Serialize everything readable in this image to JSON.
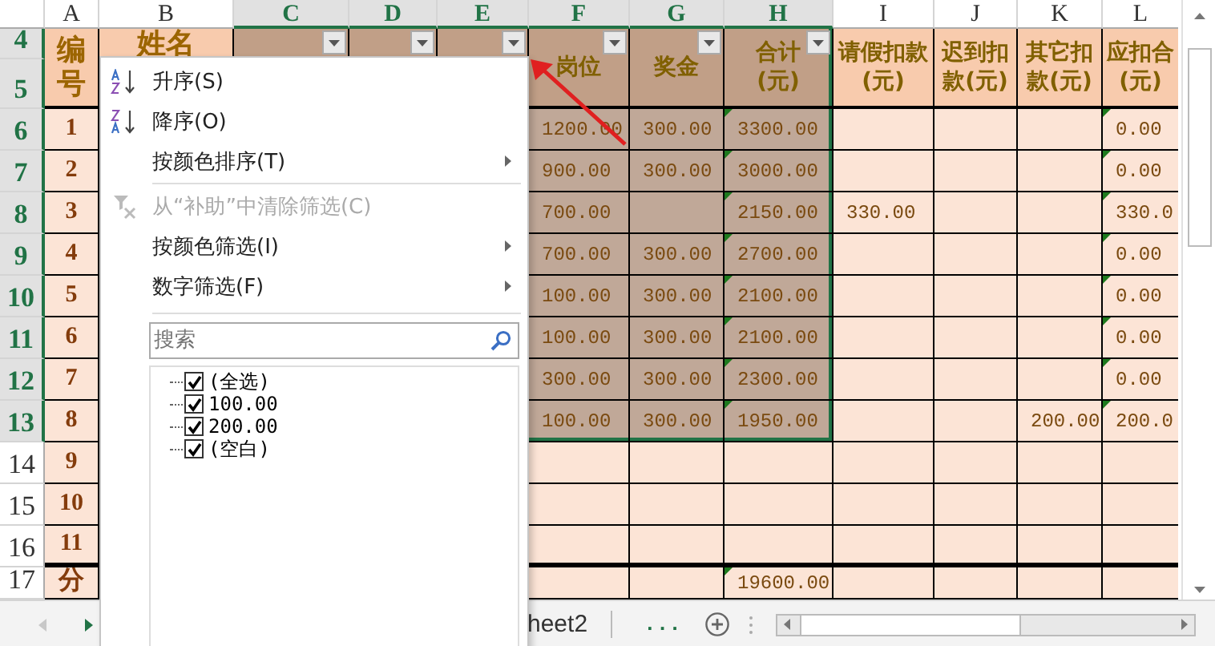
{
  "column_headers": [
    {
      "label": "A",
      "selected": false
    },
    {
      "label": "B",
      "selected": false
    },
    {
      "label": "C",
      "selected": true
    },
    {
      "label": "D",
      "selected": true
    },
    {
      "label": "E",
      "selected": true
    },
    {
      "label": "F",
      "selected": true
    },
    {
      "label": "G",
      "selected": true
    },
    {
      "label": "H",
      "selected": true
    },
    {
      "label": "I",
      "selected": false
    },
    {
      "label": "J",
      "selected": false
    },
    {
      "label": "K",
      "selected": false
    },
    {
      "label": "L",
      "selected": false
    }
  ],
  "header_rows": {
    "row_labels": [
      {
        "label": "4",
        "selected": true
      },
      {
        "label": "5",
        "selected": true
      }
    ],
    "cells": [
      {
        "text": "编号",
        "filter": false
      },
      {
        "text": "姓名",
        "filter": false
      },
      {
        "filter": true
      },
      {
        "filter": true
      },
      {
        "filter": true
      },
      {
        "text": "岗位",
        "filter": true
      },
      {
        "text": "奖金",
        "filter": true
      },
      {
        "text": "合计\n(元)",
        "filter": true
      },
      {
        "text": "请假扣款\n(元)",
        "filter": false
      },
      {
        "text": "迟到扣款(元)",
        "filter": false
      },
      {
        "text": "其它扣款(元)",
        "filter": false
      },
      {
        "text": "应扣合\n(元)",
        "filter": false
      }
    ]
  },
  "rows": [
    {
      "label": "6",
      "selected": true,
      "cells": [
        "1",
        "1200.00",
        "300.00",
        "3300.00",
        null,
        null,
        null,
        "0.00"
      ],
      "flagged": [
        false,
        false,
        false,
        true,
        false,
        false,
        false,
        true
      ]
    },
    {
      "label": "7",
      "selected": true,
      "cells": [
        "2",
        "900.00",
        "300.00",
        "3000.00",
        null,
        null,
        null,
        "0.00"
      ],
      "flagged": [
        false,
        false,
        false,
        true,
        false,
        false,
        false,
        true
      ]
    },
    {
      "label": "8",
      "selected": true,
      "cells": [
        "3",
        "700.00",
        null,
        "2150.00",
        "330.00",
        null,
        null,
        "330.0"
      ],
      "flagged": [
        false,
        false,
        false,
        true,
        false,
        false,
        false,
        true
      ]
    },
    {
      "label": "9",
      "selected": true,
      "cells": [
        "4",
        "700.00",
        "300.00",
        "2700.00",
        null,
        null,
        null,
        "0.00"
      ],
      "flagged": [
        false,
        false,
        false,
        true,
        false,
        false,
        false,
        true
      ]
    },
    {
      "label": "10",
      "selected": true,
      "cells": [
        "5",
        "100.00",
        "300.00",
        "2100.00",
        null,
        null,
        null,
        "0.00"
      ],
      "flagged": [
        false,
        false,
        false,
        true,
        false,
        false,
        false,
        true
      ]
    },
    {
      "label": "11",
      "selected": true,
      "cells": [
        "6",
        "100.00",
        "300.00",
        "2100.00",
        null,
        null,
        null,
        "0.00"
      ],
      "flagged": [
        false,
        false,
        false,
        true,
        false,
        false,
        false,
        true
      ]
    },
    {
      "label": "12",
      "selected": true,
      "cells": [
        "7",
        "300.00",
        "300.00",
        "2300.00",
        null,
        null,
        null,
        "0.00"
      ],
      "flagged": [
        false,
        false,
        false,
        true,
        false,
        false,
        false,
        true
      ]
    },
    {
      "label": "13",
      "selected": true,
      "cells": [
        "8",
        "100.00",
        "300.00",
        "1950.00",
        null,
        null,
        "200.00",
        "200.0"
      ],
      "flagged": [
        false,
        false,
        false,
        true,
        false,
        false,
        false,
        true
      ]
    },
    {
      "label": "14",
      "selected": false,
      "cells": [
        "9",
        null,
        null,
        null,
        null,
        null,
        null,
        null
      ],
      "flagged": [
        false,
        false,
        false,
        false,
        false,
        false,
        false,
        false
      ]
    },
    {
      "label": "15",
      "selected": false,
      "cells": [
        "10",
        null,
        null,
        null,
        null,
        null,
        null,
        null
      ],
      "flagged": [
        false,
        false,
        false,
        false,
        false,
        false,
        false,
        false
      ]
    },
    {
      "label": "16",
      "selected": false,
      "cells": [
        "11",
        null,
        null,
        null,
        null,
        null,
        null,
        null
      ],
      "flagged": [
        false,
        false,
        false,
        false,
        false,
        false,
        false,
        false
      ]
    },
    {
      "label": "17",
      "selected": false,
      "cells": [
        "分",
        null,
        null,
        "19600.00",
        null,
        null,
        null,
        null
      ],
      "flagged": [
        false,
        false,
        false,
        true,
        false,
        false,
        false,
        false
      ]
    }
  ],
  "menu": {
    "items": [
      {
        "kind": "sort_ascending",
        "label": "升序(S)",
        "disabled": false,
        "submenu": false
      },
      {
        "kind": "sort_descending",
        "label": "降序(O)",
        "disabled": false,
        "submenu": false
      },
      {
        "kind": "command",
        "label": "按颜色排序(T)",
        "disabled": false,
        "submenu": true
      },
      {
        "kind": "separator"
      },
      {
        "kind": "clear_filter",
        "label": "从“补助”中清除筛选(C)",
        "disabled": true,
        "submenu": false
      },
      {
        "kind": "command",
        "label": "按颜色筛选(I)",
        "disabled": false,
        "submenu": true
      },
      {
        "kind": "command",
        "label": "数字筛选(F)",
        "disabled": false,
        "submenu": true
      }
    ],
    "search": {
      "placeholder": "搜索"
    },
    "values": [
      {
        "label": "(全选)",
        "checked": true
      },
      {
        "label": "100.00",
        "checked": true
      },
      {
        "label": "200.00",
        "checked": true
      },
      {
        "label": "(空白)",
        "checked": true
      }
    ]
  },
  "sheet_tabs": [
    {
      "label": "heet2"
    }
  ],
  "more_sheets": "..."
}
